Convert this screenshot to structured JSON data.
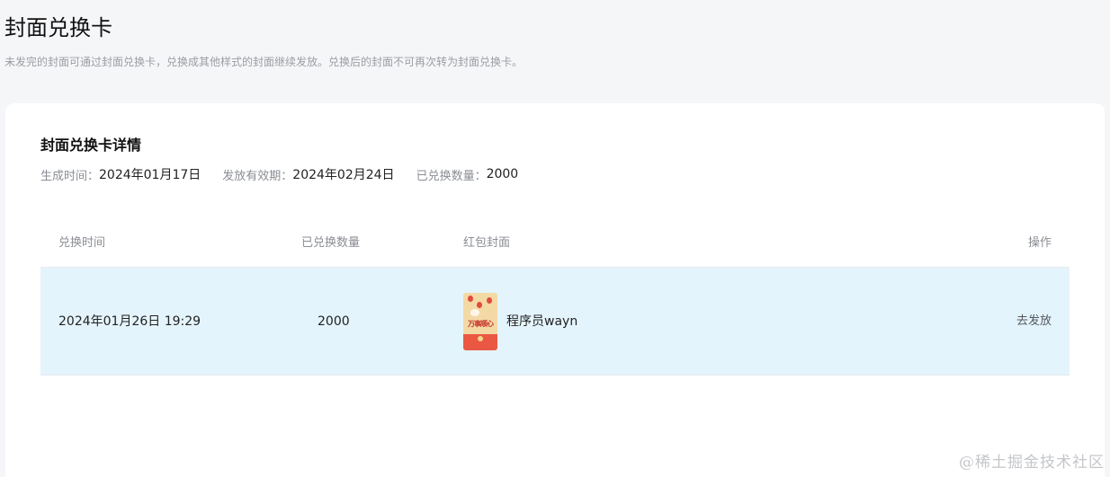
{
  "page": {
    "title": "封面兑换卡",
    "description": "未发完的封面可通过封面兑换卡，兑换成其他样式的封面继续发放。兑换后的封面不可再次转为封面兑换卡。"
  },
  "card": {
    "title": "封面兑换卡详情",
    "meta": {
      "created_label": "生成时间：",
      "created_value": "2024年01月17日",
      "valid_label": "发放有效期：",
      "valid_value": "2024年02月24日",
      "redeemed_label": "已兑换数量：",
      "redeemed_value": "2000"
    }
  },
  "table": {
    "headers": {
      "time": "兑换时间",
      "count": "已兑换数量",
      "cover": "红包封面",
      "action": "操作"
    },
    "rows": [
      {
        "time": "2024年01月26日 19:29",
        "count": "2000",
        "cover_name": "程序员wayn",
        "cover_art_text": "万事顺心",
        "action": "去发放"
      }
    ]
  },
  "watermark": "@稀土掘金技术社区",
  "colors": {
    "page_bg": "#f5f6f8",
    "row_highlight": "#e4f4fc",
    "cover_red": "#ea5844",
    "cover_gold": "#f3d9a6"
  }
}
